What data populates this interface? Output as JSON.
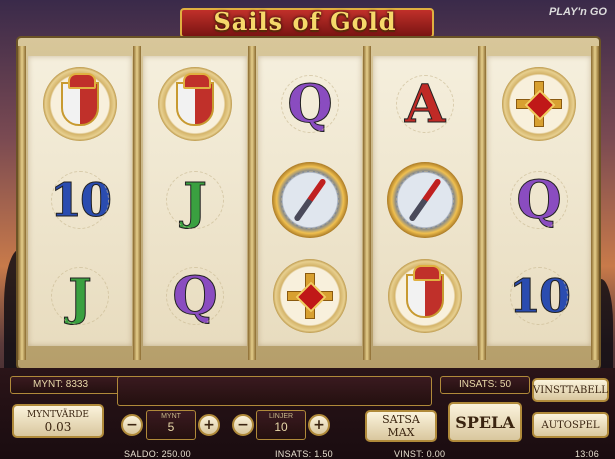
{
  "game": {
    "title": "Sails of Gold",
    "provider": "PLAY'n GO"
  },
  "reels": [
    [
      "crest",
      "ten",
      "j"
    ],
    [
      "crest",
      "j",
      "q"
    ],
    [
      "q",
      "compass",
      "cross"
    ],
    [
      "a",
      "compass",
      "crest"
    ],
    [
      "cross",
      "q",
      "ten"
    ]
  ],
  "symbols": {
    "q": "Q",
    "a": "A",
    "j": "J",
    "ten": "10"
  },
  "panel": {
    "coins_label": "MYNT: 8333",
    "bet_label": "INSATS: 50",
    "paytable_button": "VINSTTABELL",
    "coin_value_label": "MYNTVÄRDE",
    "coin_value": "0.03",
    "coins_step_label": "MYNT",
    "coins_step_value": "5",
    "lines_label": "LINJER",
    "lines_value": "10",
    "bet_max_button": "SATSA MAX",
    "spin_button": "SPELA",
    "autoplay_button": "AUTOSPEL",
    "minus": "−",
    "plus": "+"
  },
  "status": {
    "balance": "SALDO: 250.00",
    "bet": "INSATS: 1.50",
    "win": "VINST: 0.00",
    "time": "13:06"
  },
  "colors": {
    "q": "#8a4cc0",
    "a": "#c02a26",
    "j": "#3aa040",
    "ten": "#2a4cb0",
    "gold": "#b08a3a"
  }
}
